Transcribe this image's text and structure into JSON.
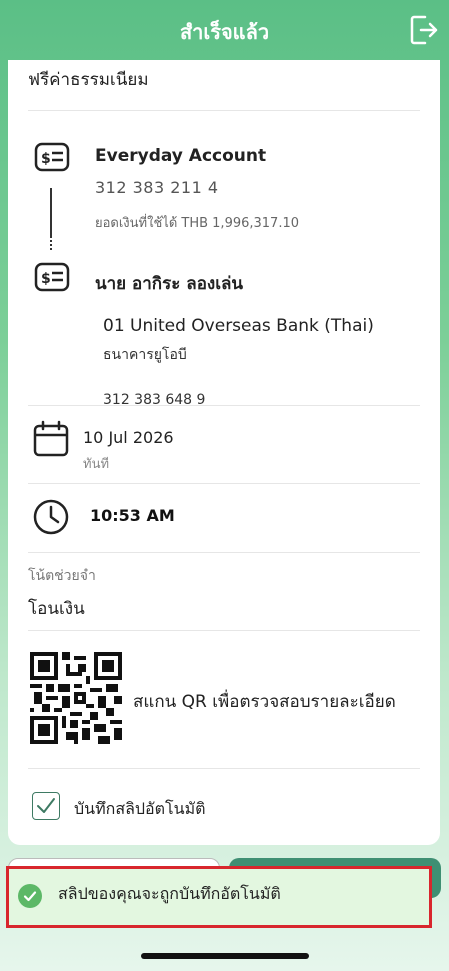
{
  "header": {
    "title": "สำเร็จแล้ว"
  },
  "fee_text": "ฟรีค่าธรรมเนียม",
  "from_account": {
    "title": "Everyday Account",
    "number": "312 383 211 4",
    "balance": "ยอดเงินที่ใช้ได้ THB 1,996,317.10"
  },
  "to_account": {
    "name": "นาย อากิระ ลองเล่น",
    "bank": "01 United Overseas Bank (Thai)",
    "bank_th": "ธนาคารยูโอบี",
    "number": "312 383 648 9"
  },
  "date": {
    "value": "10 Jul 2026",
    "sub": "ทันที"
  },
  "time": {
    "value": "10:53 AM"
  },
  "memo": {
    "label": "โน้ตช่วยจำ",
    "value": "โอนเงิน"
  },
  "qr_text": "สแกน QR เพื่อตรวจสอบรายละเอียด",
  "save_slip": {
    "label": "บันทึกสลิปอัตโนมัติ",
    "checked": true
  },
  "toast": {
    "text": "สลิปของคุณจะถูกบันทึกอัตโนมัติ"
  },
  "colors": {
    "accent": "#3f8f73",
    "toast_border": "#d8262d",
    "toast_bg": "#e3f7e0"
  }
}
